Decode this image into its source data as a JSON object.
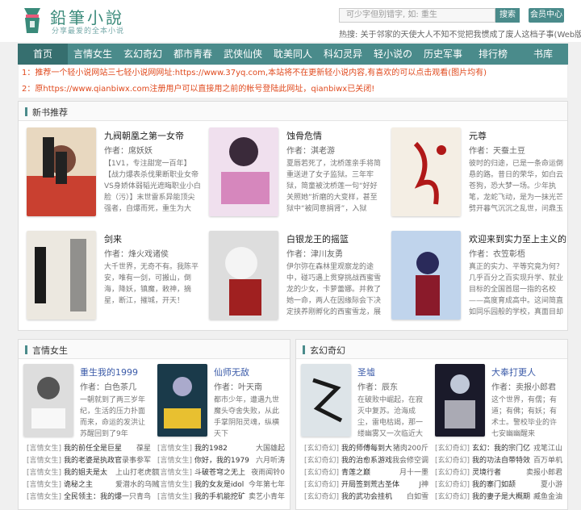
{
  "site": {
    "title": "鉛筆小說",
    "subtitle": "分享最爱的全本小说"
  },
  "search": {
    "placeholder": "可少字但别错字, 如: 重生",
    "button": "搜索"
  },
  "member_button": "会员中心",
  "hot": {
    "label": "热搜:",
    "text": "关于邻家的天使大人不知不觉把我惯成了废人这档子事(Web版)  我的"
  },
  "nav": [
    "首页",
    "言情女生",
    "玄幻奇幻",
    "都市青春",
    "武侠仙侠",
    "耽美同人",
    "科幻灵异",
    "轻小说の",
    "历史军事",
    "排行榜",
    "书库"
  ],
  "notice": [
    {
      "prefix": "1：推荐一个轻小说网站",
      "highlight": "三七轻小说网",
      "rest": "网址:https://www.37yq.com,本站将不在更新轻小说内容,有喜欢的可以点击观看(图片均有)"
    },
    {
      "prefix": "2：原",
      "highlight": "https://www.qianbiwx.com",
      "rest": "注册用户可以直接用之前的帐号登陆此网址，qianbiwx已关闭!"
    }
  ],
  "new_books": {
    "heading": "新书推荐",
    "items": [
      {
        "title": "九阀朝凰之第一女帝",
        "author": "作者：席妖妖",
        "desc": "【1V1，专注甜宠一百年】【战力爆表杀伐果断职业女帝VS身娇体弱韬光遮晦职业小白脸（污）】末世雷系异能顶尖强者，自爆而死，重生为大",
        "cover": "c1"
      },
      {
        "title": "蚀骨危情",
        "author": "作者：淇老游",
        "desc": "夏唇若死了，沈桥莲亲手将简重送进了女子监狱。三年牢狱，简童被沈桥莲一句“好好关照她”折磨的大变样，甚至狱中“被同意捐肾”，入狱",
        "cover": "c2"
      },
      {
        "title": "元尊",
        "author": "作者：天蚕土豆",
        "desc": "彼时的归途，已是一条命运倒悬的路。昔日的荣华，如白云苍狗，恐大梦一场。少年执笔，龙蛇飞动，是为一抹光芒劈开暮气沉沉之乱世，问鼎玉",
        "cover": "c3"
      },
      {
        "title": "剑来",
        "author": "作者：烽火戏诸侯",
        "desc": "大千世界，无奇不有。我陈平安，唯有一剑，可搬山，倒海，降妖，镇魔，敕神，摘星，断江，摧城，开天！",
        "cover": "c4"
      },
      {
        "title": "白银龙王的摇篮",
        "author": "作者：津川友勇",
        "desc": "伊尔弥在森林里观察龙的途中，碰巧遇上贯穿挑战西蜜雪龙的少女，卡萝蕾娜。并救了她一命，两人在因缘际会下决定挟养刚孵化的西蜜雪龙，展",
        "cover": "c5"
      },
      {
        "title": "欢迎来到实力至上主义的",
        "author": "作者：衣笠彰梧",
        "desc": "真正的实力、平等究竟为何？几乎百分之百实现升学、就业目标的全国首屈一指的名校——高度育成高中。这间简直如同乐园般的学校，真面目却",
        "cover": "c6"
      }
    ]
  },
  "romance": {
    "heading": "言情女生",
    "books": [
      {
        "title": "重生我的1999",
        "author": "作者：白色茶几",
        "desc": "一朝就到了两三岁年纪，生活的压力扑面而来，命运的发洪让苏醒回到了9年",
        "cover": "c7"
      },
      {
        "title": "仙师无敌",
        "author": "作者：叶天南",
        "desc": "都市少年，遭遇九世魔头夺舍失败，从此手掌阴阳灵魂，纵横天下",
        "cover": "c8"
      }
    ],
    "list": [
      {
        "c": "[言情女生]",
        "n": "我的前任全是巨星",
        "a": "葆星"
      },
      {
        "c": "[言情女生]",
        "n": "我的1982",
        "a": "大国雄起"
      },
      {
        "c": "[言情女生]",
        "n": "我的老婆是执政官",
        "a": "录事参军"
      },
      {
        "c": "[言情女生]",
        "n": "你好，我的1979",
        "a": "六月听涛"
      },
      {
        "c": "[言情女生]",
        "n": "我的姐夫是太",
        "a": "上山打老虎额"
      },
      {
        "c": "[言情女生]",
        "n": "斗破苍穹之无上",
        "a": "夜雨闻铃0"
      },
      {
        "c": "[言情女生]",
        "n": "诡秘之主",
        "a": "爱潜水的乌贼"
      },
      {
        "c": "[言情女生]",
        "n": "我的女友是idol",
        "a": "今年第七年"
      },
      {
        "c": "[言情女生]",
        "n": "全民领主：我的爆",
        "a": "一只青鸟"
      },
      {
        "c": "[言情女生]",
        "n": "我的手机能挖矿",
        "a": "卖艺小青年"
      }
    ]
  },
  "fantasy": {
    "heading": "玄幻奇幻",
    "books": [
      {
        "title": "圣墟",
        "author": "作者：辰东",
        "desc": "在破败中崛起，在寂灭中复苏。沧海成尘，雷电枯竭，那一缕幽雾又一次临近大",
        "cover": "c9"
      },
      {
        "title": "大奉打更人",
        "author": "作者：卖报小郎君",
        "desc": "这个世界，有儒；有道；有佛；有妖；有术士。警校毕业的许七安幽幽醒来",
        "cover": "c10"
      }
    ],
    "list": [
      {
        "c": "[玄幻奇幻]",
        "n": "我的师傅每到大",
        "a": "猪肉200斤"
      },
      {
        "c": "[玄幻奇幻]",
        "n": "玄幻：我的宗门亿",
        "a": "戎笔江山"
      },
      {
        "c": "[玄幻奇幻]",
        "n": "我的治愈系游戏",
        "a": "我会修空调"
      },
      {
        "c": "[玄幻奇幻]",
        "n": "我的功法自带特效",
        "a": "百万单机"
      },
      {
        "c": "[玄幻奇幻]",
        "n": "青莲之巅",
        "a": "月十一墨"
      },
      {
        "c": "[玄幻奇幻]",
        "n": "灵境行者",
        "a": "卖报小郎君"
      },
      {
        "c": "[玄幻奇幻]",
        "n": "开局签到荒古圣体",
        "a": "J神"
      },
      {
        "c": "[玄幻奇幻]",
        "n": "我的寨门如颉",
        "a": "夏小游"
      },
      {
        "c": "[玄幻奇幻]",
        "n": "我的武功会挂机",
        "a": "白如雪"
      },
      {
        "c": "[玄幻奇幻]",
        "n": "我的妻子是大概期",
        "a": "臧鱼金油"
      }
    ]
  }
}
